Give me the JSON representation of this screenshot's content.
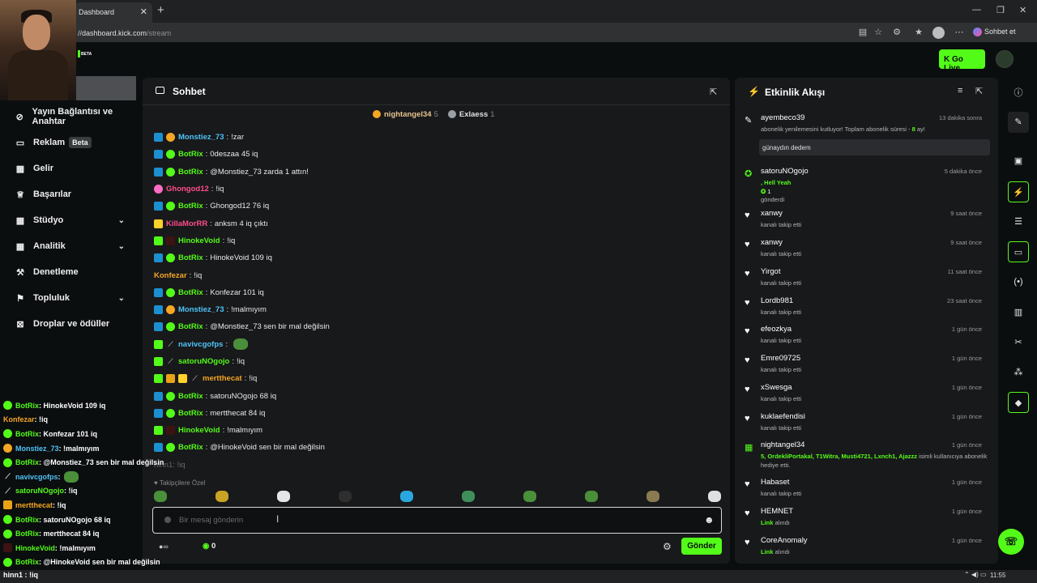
{
  "browser": {
    "tab_title": "Dashboard",
    "url_host": "dashboard.kick.com",
    "url_path": "/stream",
    "copilot_label": "Sohbet et",
    "beta": "BETA"
  },
  "header": {
    "go_live": "Go Live"
  },
  "sidebar": {
    "items": [
      {
        "label": "Yayın Bağlantısı ve Anahtar",
        "icon": "link-icon"
      },
      {
        "label": "Reklam",
        "badge": "Beta",
        "icon": "ad-icon"
      },
      {
        "label": "Gelir",
        "icon": "revenue-icon"
      },
      {
        "label": "Başarılar",
        "icon": "trophy-icon"
      },
      {
        "label": "Stüdyo",
        "icon": "studio-icon",
        "chevron": true
      },
      {
        "label": "Analitik",
        "icon": "chart-icon",
        "chevron": true
      },
      {
        "label": "Denetleme",
        "icon": "hammer-icon"
      },
      {
        "label": "Topluluk",
        "icon": "community-icon",
        "chevron": true
      },
      {
        "label": "Droplar ve ödüller",
        "icon": "drops-icon"
      }
    ]
  },
  "chat": {
    "title": "Sohbet",
    "pinned": [
      {
        "name": "nightangel34",
        "count": "5"
      },
      {
        "name": "Exlaess",
        "count": "1"
      }
    ],
    "messages": [
      {
        "user": "Monstiez_73",
        "color": "#4fc3f7",
        "badges": [
          "bot",
          "sub"
        ],
        "text": "!zar"
      },
      {
        "user": "BotRix",
        "color": "#53fc18",
        "badges": [
          "bot",
          "ver"
        ],
        "text": "0deszaa 45 iq"
      },
      {
        "user": "BotRix",
        "color": "#53fc18",
        "badges": [
          "bot",
          "ver"
        ],
        "text": "@Monstiez_73 zarda 1 attın!"
      },
      {
        "user": "Ghongod12",
        "color": "#ff4d8a",
        "badges": [
          "pink"
        ],
        "text": "!iq"
      },
      {
        "user": "BotRix",
        "color": "#53fc18",
        "badges": [
          "bot",
          "ver"
        ],
        "text": "Ghongod12 76 iq"
      },
      {
        "user": "KillaMorRR",
        "color": "#ff4d8a",
        "badges": [
          "yel"
        ],
        "text": "anksm 4 iq çıktı"
      },
      {
        "user": "HinokeVoid",
        "color": "#53fc18",
        "badges": [
          "grn",
          "dark"
        ],
        "text": "!iq"
      },
      {
        "user": "BotRix",
        "color": "#53fc18",
        "badges": [
          "bot",
          "ver"
        ],
        "text": "HinokeVoid 109 iq"
      },
      {
        "user": "Konfezar",
        "color": "#f5a623",
        "badges": [],
        "text": "!iq"
      },
      {
        "user": "BotRix",
        "color": "#53fc18",
        "badges": [
          "bot",
          "ver"
        ],
        "text": "Konfezar 101 iq"
      },
      {
        "user": "Monstiez_73",
        "color": "#4fc3f7",
        "badges": [
          "bot",
          "sub"
        ],
        "text": "!malmıyım"
      },
      {
        "user": "BotRix",
        "color": "#53fc18",
        "badges": [
          "bot",
          "ver"
        ],
        "text": "@Monstiez_73 sen bir mal değilsin"
      },
      {
        "user": "navivcgofps",
        "color": "#4fc3f7",
        "badges": [
          "grn",
          "sword"
        ],
        "text": "",
        "emote": true
      },
      {
        "user": "satoruNOgojo",
        "color": "#53fc18",
        "badges": [
          "grn",
          "sword"
        ],
        "text": "!iq"
      },
      {
        "user": "mertthecat",
        "color": "#f5a623",
        "badges": [
          "grn",
          "crown",
          "yel",
          "sword"
        ],
        "text": "!iq"
      },
      {
        "user": "BotRix",
        "color": "#53fc18",
        "badges": [
          "bot",
          "ver"
        ],
        "text": "satoruNOgojo 68 iq"
      },
      {
        "user": "BotRix",
        "color": "#53fc18",
        "badges": [
          "bot",
          "ver"
        ],
        "text": "mertthecat 84 iq"
      },
      {
        "user": "HinokeVoid",
        "color": "#53fc18",
        "badges": [
          "grn",
          "dark"
        ],
        "text": "!malmıyım"
      },
      {
        "user": "BotRix",
        "color": "#53fc18",
        "badges": [
          "bot",
          "ver"
        ],
        "text": "@HinokeVoid sen bir mal değilsin"
      }
    ],
    "typing": "hinn1: !iq",
    "emote_section": "Takipçilere Özel",
    "input_placeholder": "Bir mesaj gönderin",
    "follower_count": "0",
    "send": "Gönder"
  },
  "feed": {
    "title": "Etkinlik Akışı",
    "items": [
      {
        "icon": "resub-icon",
        "name": "ayembeco39",
        "time": "13 dakika sonra",
        "sub_pre": "abonelik yenilemesini kutluyor! Toplam abonelik süresi - ",
        "sub_hl": "8",
        "sub_post": " ay!",
        "message": "günaydın dedem"
      },
      {
        "icon": "kicks-icon",
        "name": "satoruNOgojo",
        "time": "5 dakika önce",
        "sub_hl": ", Hell Yeah",
        "amount": "1",
        "sub_post": "gönderdi"
      },
      {
        "icon": "heart-icon",
        "name": "xanwy",
        "time": "9 saat önce",
        "sub_post": "kanalı takip etti"
      },
      {
        "icon": "heart-icon",
        "name": "xanwy",
        "time": "9 saat önce",
        "sub_post": "kanalı takip etti"
      },
      {
        "icon": "heart-icon",
        "name": "Yirgot",
        "time": "11 saat önce",
        "sub_post": "kanalı takip etti"
      },
      {
        "icon": "heart-icon",
        "name": "Lordb981",
        "time": "23 saat önce",
        "sub_post": "kanalı takip etti"
      },
      {
        "icon": "heart-icon",
        "name": "efeozkya",
        "time": "1 gün önce",
        "sub_post": "kanalı takip etti"
      },
      {
        "icon": "heart-icon",
        "name": "Emre09725",
        "time": "1 gün önce",
        "sub_post": "kanalı takip etti"
      },
      {
        "icon": "heart-icon",
        "name": "xSwesga",
        "time": "1 gün önce",
        "sub_post": "kanalı takip etti"
      },
      {
        "icon": "heart-icon",
        "name": "kuklaefendisi",
        "time": "1 gün önce",
        "sub_post": "kanalı takip etti"
      },
      {
        "icon": "gift-icon",
        "name": "nightangel34",
        "time": "1 gün önce",
        "sub_hl": "5, OrdekliPortakal, T1Witra, Musti4721, Lxnch1, Ajazzz",
        "sub_post": " isimli kullanıcıya abonelik hediye etti."
      },
      {
        "icon": "heart-icon",
        "name": "Habaset",
        "time": "1 gün önce",
        "sub_post": "kanalı takip etti"
      },
      {
        "icon": "heart-icon",
        "name": "HEMNET",
        "time": "1 gün önce",
        "sub_hl": "Link",
        "sub_post": " alındı"
      },
      {
        "icon": "heart-icon",
        "name": "CoreAnomaly",
        "time": "1 gün önce",
        "sub_hl": "Link",
        "sub_post": " alındı"
      }
    ]
  },
  "overlay": {
    "messages": [
      {
        "user": "BotRix",
        "color": "#53fc18",
        "text": " : HinokeVoid 109 iq",
        "b": "bot"
      },
      {
        "user": "Konfezar",
        "color": "#f5a623",
        "text": " : !iq",
        "b": ""
      },
      {
        "user": "BotRix",
        "color": "#53fc18",
        "text": " : Konfezar 101 iq",
        "b": "bot"
      },
      {
        "user": "Monstiez_73",
        "color": "#4fc3f7",
        "text": " : !malmıyım",
        "b": "sub"
      },
      {
        "user": "BotRix",
        "color": "#53fc18",
        "text": " : @Monstiez_73 sen bir mal değilsin",
        "b": "bot"
      },
      {
        "user": "navivcgofps",
        "color": "#4fc3f7",
        "text": " : ",
        "b": "sword",
        "emote": true
      },
      {
        "user": "satoruNOgojo",
        "color": "#53fc18",
        "text": " : !iq",
        "b": "sword"
      },
      {
        "user": "mertthecat",
        "color": "#f5a623",
        "text": " : !iq",
        "b": "crown"
      },
      {
        "user": "BotRix",
        "color": "#53fc18",
        "text": " : satoruNOgojo 68 iq",
        "b": "bot"
      },
      {
        "user": "BotRix",
        "color": "#53fc18",
        "text": " : mertthecat 84 iq",
        "b": "bot"
      },
      {
        "user": "HinokeVoid",
        "color": "#53fc18",
        "text": " : !malmıyım",
        "b": "dark"
      },
      {
        "user": "BotRix",
        "color": "#53fc18",
        "text": " : @HinokeVoid sen bir mal değilsin",
        "b": "bot"
      }
    ]
  },
  "taskbar": {
    "left": "hinn1 : !iq",
    "time": "11:55"
  }
}
